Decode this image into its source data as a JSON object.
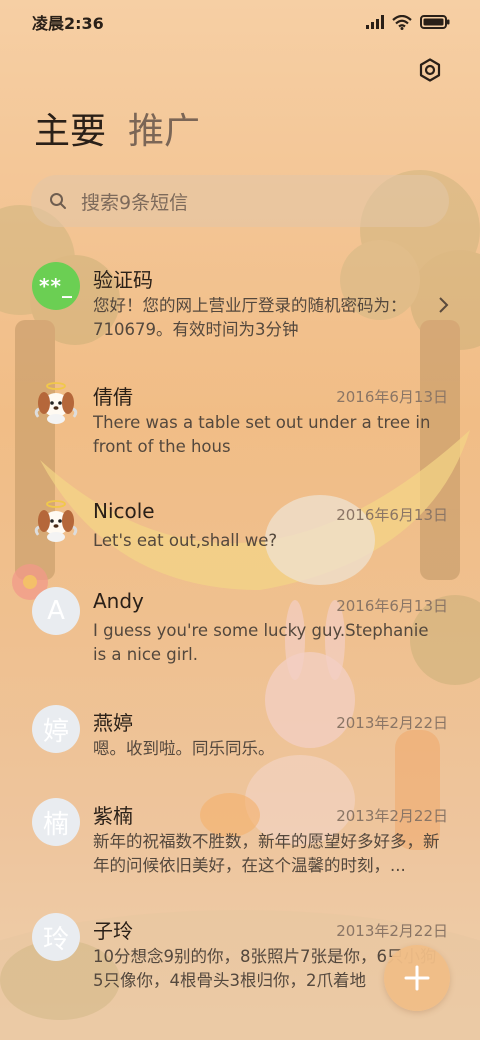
{
  "status_bar": {
    "time": "凌晨2:36",
    "icons": [
      "signal-icon",
      "wifi-icon",
      "battery-icon"
    ]
  },
  "header": {
    "tabs": [
      {
        "label": "主要",
        "active": true
      },
      {
        "label": "推广",
        "active": false
      }
    ],
    "settings_icon": "settings-icon"
  },
  "search": {
    "placeholder": "搜索9条短信",
    "icon": "search-icon"
  },
  "conversations": [
    {
      "name": "验证码",
      "avatar_text": "**_",
      "avatar_color": "#6bcf53",
      "date": "",
      "preview": "您好！您的网上营业厅登录的随机密码为：710679。有效时间为3分钟",
      "has_chevron": true
    },
    {
      "name": "倩倩",
      "avatar_text": "",
      "avatar_image": "dog-avatar",
      "date": "2016年6月13日",
      "preview": "There was a table set out under a tree in front of the hous"
    },
    {
      "name": "Nicole",
      "avatar_text": "",
      "avatar_image": "dog-avatar",
      "date": "2016年6月13日",
      "preview": "Let's eat out,shall we?"
    },
    {
      "name": "Andy",
      "avatar_text": "A",
      "date": "2016年6月13日",
      "preview": "I guess you're some lucky guy.Stephanie is a nice girl."
    },
    {
      "name": "燕婷",
      "avatar_text": "婷",
      "date": "2013年2月22日",
      "preview": "嗯。收到啦。同乐同乐。"
    },
    {
      "name": "紫楠",
      "avatar_text": "楠",
      "date": "2013年2月22日",
      "preview": "新年的祝福数不胜数，新年的愿望好多好多，新年的问候依旧美好，在这个温馨的时刻，..."
    },
    {
      "name": "子玲",
      "avatar_text": "玲",
      "date": "2013年2月22日",
      "preview": "10分想念9别的你，8张照片7张是你，6只小狗5只像你，4根骨头3根归你，2爪着地"
    }
  ],
  "fab": {
    "icon": "plus-icon"
  },
  "colors": {
    "background": "#f3c493",
    "avatar_placeholder": "#e9ecf0",
    "fab": "#f0be87"
  }
}
